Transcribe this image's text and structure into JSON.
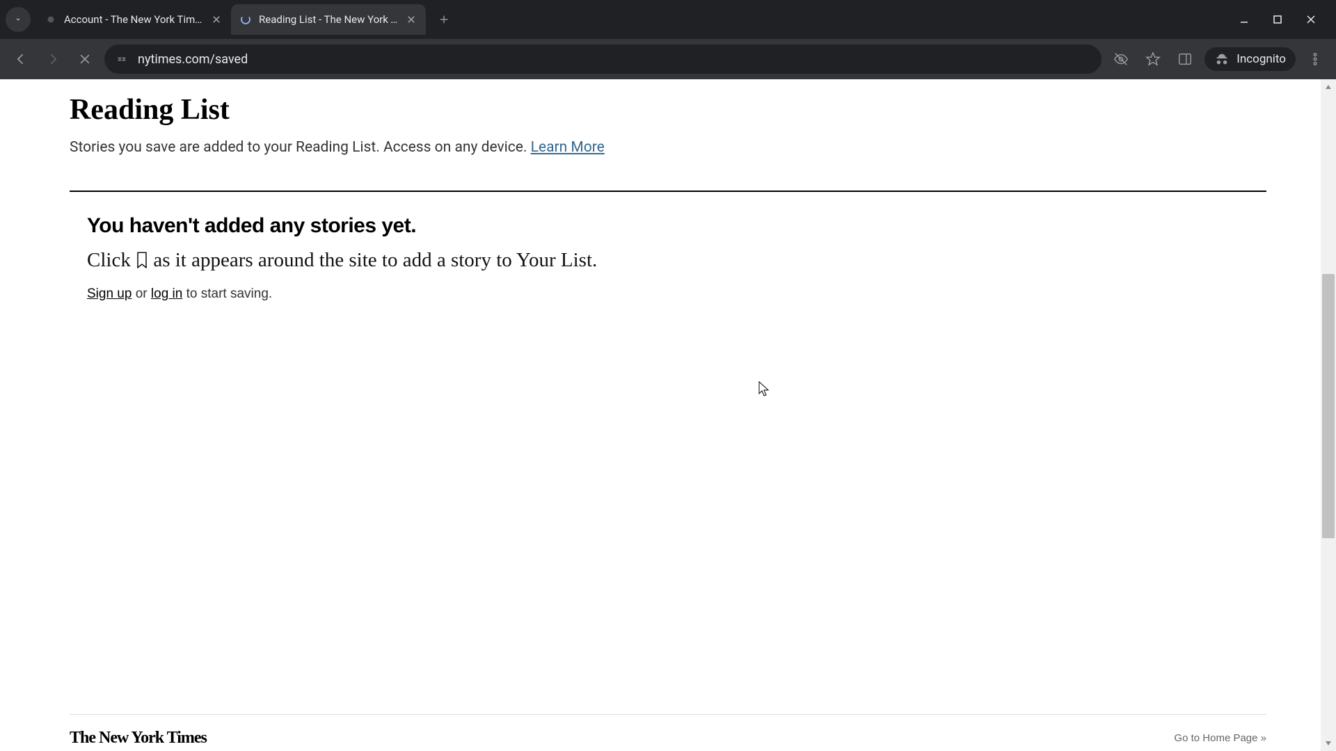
{
  "browser": {
    "tabs": [
      {
        "title": "Account - The New York Times",
        "active": false,
        "loading": false
      },
      {
        "title": "Reading List - The New York Times",
        "active": true,
        "loading": true
      }
    ],
    "url": "nytimes.com/saved",
    "incognito_label": "Incognito"
  },
  "page": {
    "title": "Reading List",
    "subtitle_prefix": "Stories you save are added to your Reading List. Access on any device. ",
    "learn_more": "Learn More",
    "empty_heading": "You haven't added any stories yet.",
    "empty_prefix": "Click ",
    "empty_suffix": " as it appears around the site to add a story to Your List.",
    "signup_label": "Sign up",
    "or_text": " or ",
    "login_label": "log in",
    "signin_suffix": " to start saving.",
    "footer_logo": "The New York Times",
    "footer_link": "Go to Home Page »"
  }
}
